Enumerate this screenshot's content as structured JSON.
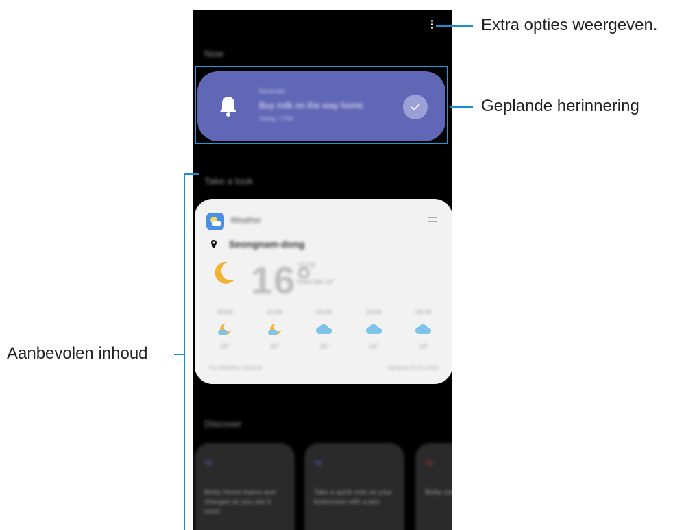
{
  "callouts": {
    "more_options": "Extra opties weergeven.",
    "scheduled_reminder": "Geplande herinnering",
    "recommended_content": "Aanbevolen inhoud"
  },
  "screen": {
    "section_now": "Now",
    "section_take_a_look": "Take a look",
    "section_discover": "Discover",
    "reminder": {
      "small_label": "Reminder",
      "text": "Buy milk on the way home",
      "time": "Today, 7 PM",
      "icon": "bell-icon"
    },
    "weather": {
      "app_name": "Weather",
      "location": "Seongnam-dong",
      "temperature": "16°",
      "unit": "°C/°F",
      "feels_like": "Feels like 14°",
      "forecast": [
        {
          "time": "20:00",
          "icon": "moon-cloud-icon",
          "temp": "16°"
        },
        {
          "time": "21:00",
          "icon": "moon-cloud-icon",
          "temp": "15°"
        },
        {
          "time": "22:00",
          "icon": "cloud-icon",
          "temp": "15°"
        },
        {
          "time": "23:00",
          "icon": "cloud-icon",
          "temp": "14°"
        },
        {
          "time": "00:00",
          "icon": "cloud-icon",
          "temp": "14°"
        }
      ],
      "source": "The Weather Channel",
      "updated": "Updated 20:10 10/10"
    },
    "discover": [
      {
        "tag": "Tip",
        "text": "Bixby Home learns and changes as you use it more"
      },
      {
        "tag": "Tip",
        "text": "Take a quick note on your lockscreen with a pen"
      },
      {
        "tag": "Tip",
        "text": "Bixby can suggest more"
      }
    ]
  },
  "colors": {
    "accent": "#1a9ad6",
    "reminder_card": "#6067b6"
  }
}
